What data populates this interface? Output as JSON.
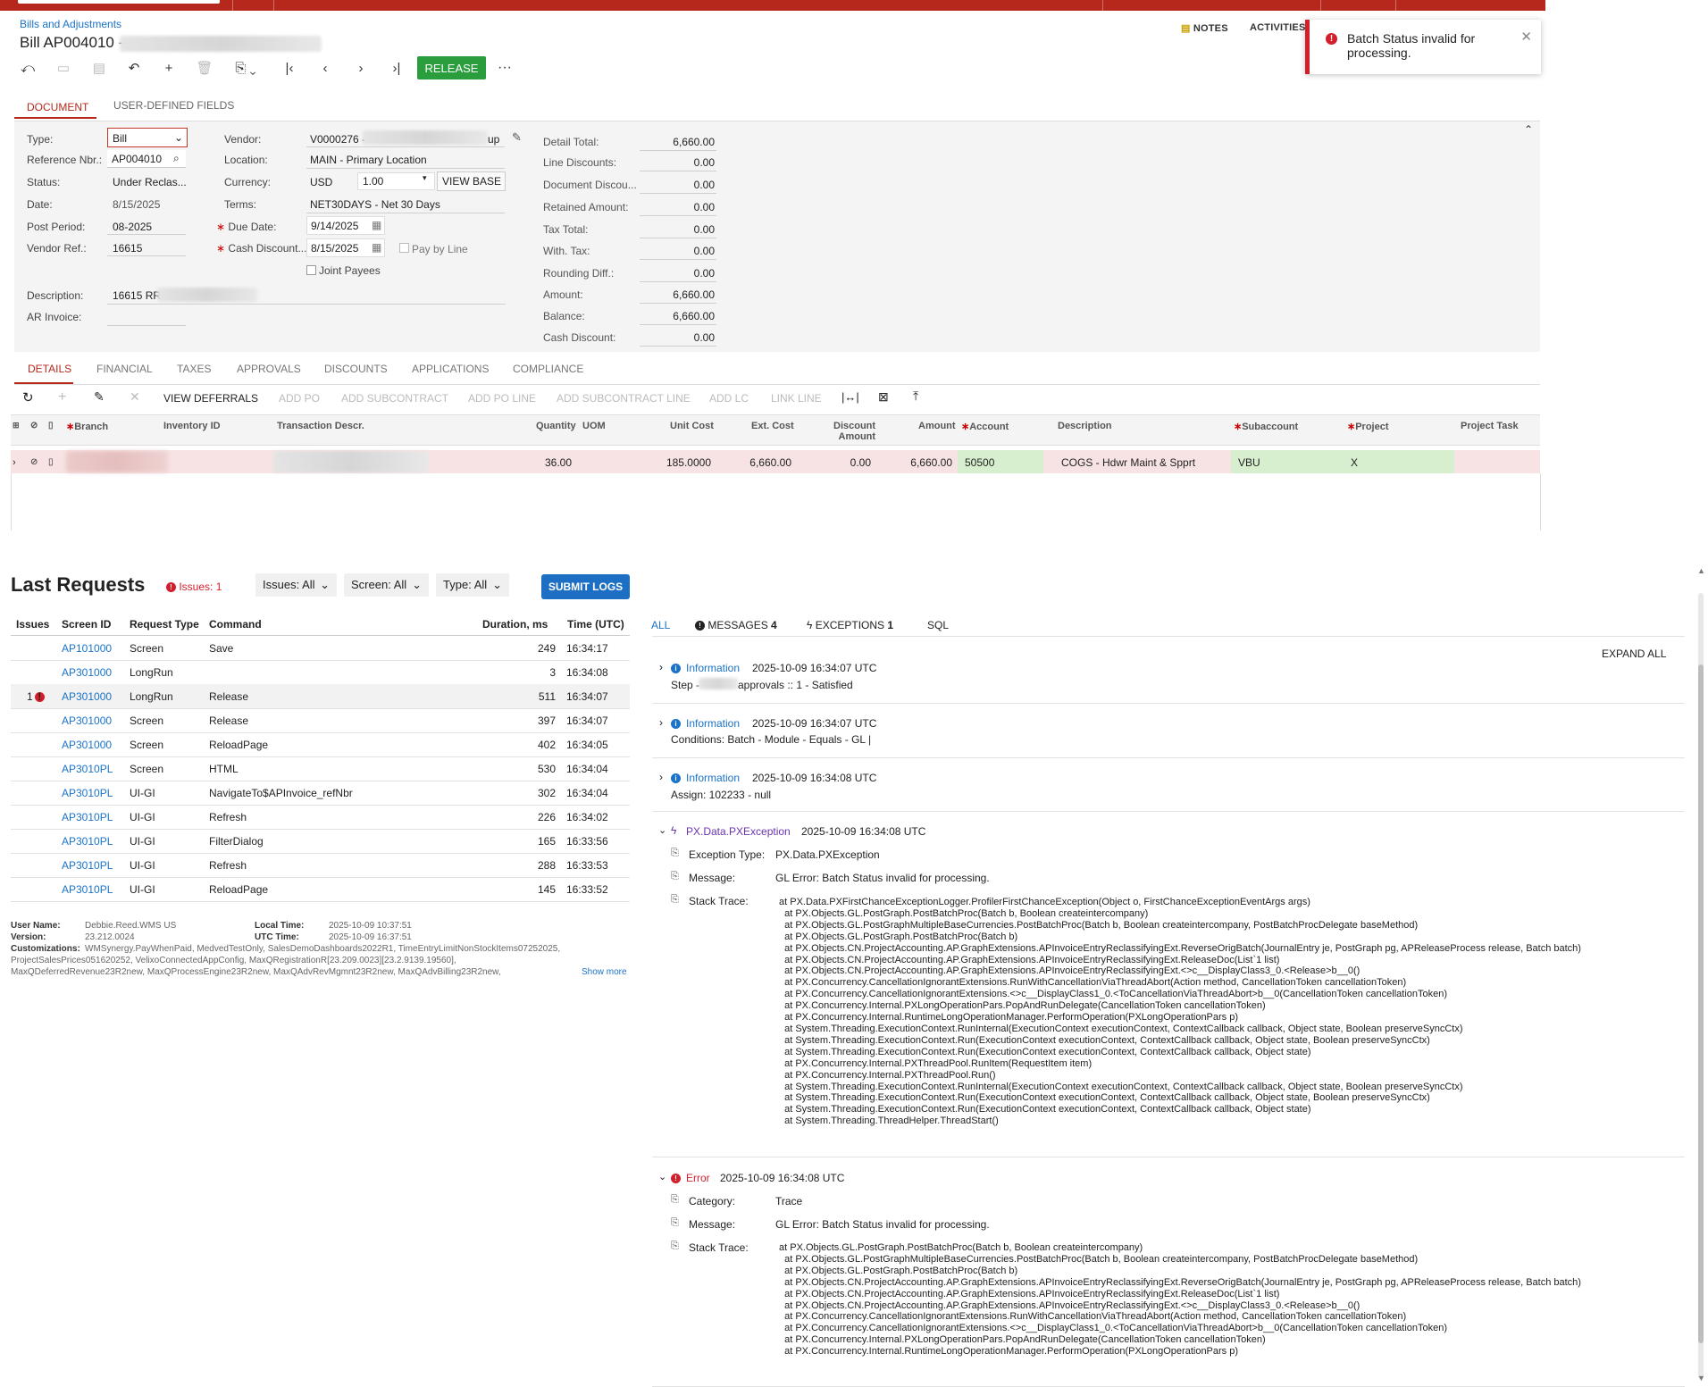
{
  "colors": {
    "brand_red": "#b5281b",
    "release_green": "#2a9d3c",
    "link_blue": "#1a73c8",
    "error_red": "#d21f2b",
    "exception_purple": "#6a33b0"
  },
  "header": {
    "breadcrumb": "Bills and Adjustments",
    "title": "Bill AP004010 -",
    "notes": "NOTES",
    "activities": "ACTIVITIES",
    "release": "RELEASE",
    "more": "···"
  },
  "toast": {
    "message": "Batch Status invalid for processing.",
    "close": "✕",
    "icon": "!"
  },
  "form_tabs": [
    "DOCUMENT",
    "USER-DEFINED FIELDS"
  ],
  "summary": {
    "type_label": "Type:",
    "type_value": "Bill",
    "refnbr_label": "Reference Nbr.:",
    "refnbr_value": "AP004010",
    "status_label": "Status:",
    "status_value": "Under Reclas...",
    "date_label": "Date:",
    "date_value": "8/15/2025",
    "postperiod_label": "Post Period:",
    "postperiod_value": "08-2025",
    "vendorref_label": "Vendor Ref.:",
    "vendorref_value": "16615",
    "description_label": "Description:",
    "description_value": "16615 RR",
    "arinvoice_label": "AR Invoice:",
    "vendor_label": "Vendor:",
    "vendor_value": "V0000276 -",
    "vendor_suffix": "up",
    "location_label": "Location:",
    "location_value": "MAIN - Primary Location",
    "currency_label": "Currency:",
    "currency_value": "USD",
    "rate_value": "1.00",
    "viewbase": "VIEW BASE",
    "terms_label": "Terms:",
    "terms_value": "NET30DAYS - Net 30 Days",
    "duedate_label": "Due Date:",
    "duedate_value": "9/14/2025",
    "cashdisc_label": "Cash Discount...",
    "cashdisc_value": "8/15/2025",
    "paybyline": "Pay by Line",
    "jointpayees": "Joint Payees"
  },
  "totals": [
    {
      "label": "Detail Total:",
      "value": "6,660.00"
    },
    {
      "label": "Line Discounts:",
      "value": "0.00"
    },
    {
      "label": "Document Discou...",
      "value": "0.00"
    },
    {
      "label": "Retained Amount:",
      "value": "0.00"
    },
    {
      "label": "Tax Total:",
      "value": "0.00"
    },
    {
      "label": "With. Tax:",
      "value": "0.00"
    },
    {
      "label": "Rounding Diff.:",
      "value": "0.00"
    },
    {
      "label": "Amount:",
      "value": "6,660.00"
    },
    {
      "label": "Balance:",
      "value": "6,660.00"
    },
    {
      "label": "Cash Discount:",
      "value": "0.00"
    }
  ],
  "grid_tabs": [
    "DETAILS",
    "FINANCIAL",
    "TAXES",
    "APPROVALS",
    "DISCOUNTS",
    "APPLICATIONS",
    "COMPLIANCE"
  ],
  "grid_toolbar": [
    "VIEW DEFERRALS",
    "ADD PO",
    "ADD SUBCONTRACT",
    "ADD PO LINE",
    "ADD SUBCONTRACT LINE",
    "ADD LC",
    "LINK LINE"
  ],
  "grid_headers": {
    "branch": "Branch",
    "inventory": "Inventory ID",
    "trandesc": "Transaction Descr.",
    "quantity": "Quantity",
    "uom": "UOM",
    "unitcost": "Unit Cost",
    "extcost": "Ext. Cost",
    "discamt1": "Discount",
    "discamt2": "Amount",
    "amount": "Amount",
    "account": "Account",
    "description": "Description",
    "subaccount": "Subaccount",
    "project": "Project",
    "projecttask": "Project Task"
  },
  "grid_row": {
    "quantity": "36.00",
    "unitcost": "185.0000",
    "extcost": "6,660.00",
    "discount": "0.00",
    "amount": "6,660.00",
    "account": "50500",
    "description": "COGS - Hdwr Maint & Spprt",
    "subaccount": "VBU",
    "project": "X"
  },
  "requests": {
    "title": "Last Requests",
    "issues_badge": "Issues: 1",
    "filters": [
      "Issues: All",
      "Screen: All",
      "Type: All"
    ],
    "submit": "SUBMIT LOGS",
    "columns": [
      "Issues",
      "Screen ID",
      "Request Type",
      "Command",
      "Duration, ms",
      "Time (UTC)"
    ],
    "rows": [
      {
        "issues": "",
        "screen": "AP101000",
        "type": "Screen",
        "command": "Save",
        "duration": "249",
        "time": "16:34:17"
      },
      {
        "issues": "",
        "screen": "AP301000",
        "type": "LongRun",
        "command": "",
        "duration": "3",
        "time": "16:34:08"
      },
      {
        "issues": "1",
        "screen": "AP301000",
        "type": "LongRun",
        "command": "Release",
        "duration": "511",
        "time": "16:34:07"
      },
      {
        "issues": "",
        "screen": "AP301000",
        "type": "Screen",
        "command": "Release",
        "duration": "397",
        "time": "16:34:07"
      },
      {
        "issues": "",
        "screen": "AP301000",
        "type": "Screen",
        "command": "ReloadPage",
        "duration": "402",
        "time": "16:34:05"
      },
      {
        "issues": "",
        "screen": "AP3010PL",
        "type": "Screen",
        "command": "HTML",
        "duration": "530",
        "time": "16:34:04"
      },
      {
        "issues": "",
        "screen": "AP3010PL",
        "type": "UI-GI",
        "command": "NavigateTo$APInvoice_refNbr",
        "duration": "302",
        "time": "16:34:04"
      },
      {
        "issues": "",
        "screen": "AP3010PL",
        "type": "UI-GI",
        "command": "Refresh",
        "duration": "226",
        "time": "16:34:02"
      },
      {
        "issues": "",
        "screen": "AP3010PL",
        "type": "UI-GI",
        "command": "FilterDialog",
        "duration": "165",
        "time": "16:33:56"
      },
      {
        "issues": "",
        "screen": "AP3010PL",
        "type": "UI-GI",
        "command": "Refresh",
        "duration": "288",
        "time": "16:33:53"
      },
      {
        "issues": "",
        "screen": "AP3010PL",
        "type": "UI-GI",
        "command": "ReloadPage",
        "duration": "145",
        "time": "16:33:52"
      }
    ],
    "meta": {
      "username_label": "User Name:",
      "username": "Debbie.Reed.WMS US",
      "version_label": "Version:",
      "version": "23.212.0024",
      "localtime_label": "Local Time:",
      "localtime": "2025-10-09 10:37:51",
      "utctime_label": "UTC Time:",
      "utctime": "2025-10-09 16:37:51",
      "custom_label": "Customizations:",
      "custom_line1": "WMSynergy.PayWhenPaid, MedvedTestOnly, SalesDemoDashboards2022R1, TimeEntryLimitNonStockItems07252025,",
      "custom_line2": "ProjectSalesPrices051620252, VelixoConnectedAppConfig, MaxQRegistrationR[23.209.0023][23.2.9139.19560],",
      "custom_line3": "MaxQDeferredRevenue23R2new, MaxQProcessEngine23R2new, MaxQAdvRevMgmnt23R2new, MaxQAdvBilling23R2new,",
      "showmore": "Show more"
    }
  },
  "log": {
    "tabs": {
      "all": "ALL",
      "messages": "MESSAGES",
      "messages_count": "4",
      "exceptions": "EXCEPTIONS",
      "exceptions_count": "1",
      "sql": "SQL"
    },
    "expand_all": "EXPAND ALL",
    "entries": [
      {
        "level": "Information",
        "time": "2025-10-09 16:34:07 UTC",
        "text_a": "Step -",
        "text_b": "approvals :: 1 - Satisfied"
      },
      {
        "level": "Information",
        "time": "2025-10-09 16:34:07 UTC",
        "text": "Conditions: Batch - Module - Equals - GL |"
      },
      {
        "level": "Information",
        "time": "2025-10-09 16:34:08 UTC",
        "text": "Assign: 102233 - null"
      }
    ],
    "exception": {
      "title": "PX.Data.PXException",
      "time": "2025-10-09 16:34:08 UTC",
      "type_label": "Exception Type:",
      "type": "PX.Data.PXException",
      "message_label": "Message:",
      "message": "GL Error: Batch Status invalid for processing.",
      "stack_label": "Stack Trace:",
      "stack": "at PX.Data.PXFirstChanceExceptionLogger.ProfilerFirstChanceException(Object o, FirstChanceExceptionEventArgs args)\n  at PX.Objects.GL.PostGraph.PostBatchProc(Batch b, Boolean createintercompany)\n  at PX.Objects.GL.PostGraphMultipleBaseCurrencies.PostBatchProc(Batch b, Boolean createintercompany, PostBatchProcDelegate baseMethod)\n  at PX.Objects.GL.PostGraph.PostBatchProc(Batch b)\n  at PX.Objects.CN.ProjectAccounting.AP.GraphExtensions.APInvoiceEntryReclassifyingExt.ReverseOrigBatch(JournalEntry je, PostGraph pg, APReleaseProcess release, Batch batch)\n  at PX.Objects.CN.ProjectAccounting.AP.GraphExtensions.APInvoiceEntryReclassifyingExt.ReleaseDoc(List`1 list)\n  at PX.Objects.CN.ProjectAccounting.AP.GraphExtensions.APInvoiceEntryReclassifyingExt.<>c__DisplayClass3_0.<Release>b__0()\n  at PX.Concurrency.CancellationIgnorantExtensions.RunWithCancellationViaThreadAbort(Action method, CancellationToken cancellationToken)\n  at PX.Concurrency.CancellationIgnorantExtensions.<>c__DisplayClass1_0.<ToCancellationViaThreadAbort>b__0(CancellationToken cancellationToken)\n  at PX.Concurrency.Internal.PXLongOperationPars.PopAndRunDelegate(CancellationToken cancellationToken)\n  at PX.Concurrency.Internal.RuntimeLongOperationManager.PerformOperation(PXLongOperationPars p)\n  at System.Threading.ExecutionContext.RunInternal(ExecutionContext executionContext, ContextCallback callback, Object state, Boolean preserveSyncCtx)\n  at System.Threading.ExecutionContext.Run(ExecutionContext executionContext, ContextCallback callback, Object state, Boolean preserveSyncCtx)\n  at System.Threading.ExecutionContext.Run(ExecutionContext executionContext, ContextCallback callback, Object state)\n  at PX.Concurrency.Internal.PXThreadPool.RunItem(RequestItem item)\n  at PX.Concurrency.Internal.PXThreadPool.Run()\n  at System.Threading.ExecutionContext.RunInternal(ExecutionContext executionContext, ContextCallback callback, Object state, Boolean preserveSyncCtx)\n  at System.Threading.ExecutionContext.Run(ExecutionContext executionContext, ContextCallback callback, Object state, Boolean preserveSyncCtx)\n  at System.Threading.ExecutionContext.Run(ExecutionContext executionContext, ContextCallback callback, Object state)\n  at System.Threading.ThreadHelper.ThreadStart()"
    },
    "error": {
      "title": "Error",
      "time": "2025-10-09 16:34:08 UTC",
      "category_label": "Category:",
      "category": "Trace",
      "message_label": "Message:",
      "message": "GL Error: Batch Status invalid for processing.",
      "stack_label": "Stack Trace:",
      "stack": "at PX.Objects.GL.PostGraph.PostBatchProc(Batch b, Boolean createintercompany)\n  at PX.Objects.GL.PostGraphMultipleBaseCurrencies.PostBatchProc(Batch b, Boolean createintercompany, PostBatchProcDelegate baseMethod)\n  at PX.Objects.GL.PostGraph.PostBatchProc(Batch b)\n  at PX.Objects.CN.ProjectAccounting.AP.GraphExtensions.APInvoiceEntryReclassifyingExt.ReverseOrigBatch(JournalEntry je, PostGraph pg, APReleaseProcess release, Batch batch)\n  at PX.Objects.CN.ProjectAccounting.AP.GraphExtensions.APInvoiceEntryReclassifyingExt.ReleaseDoc(List`1 list)\n  at PX.Objects.CN.ProjectAccounting.AP.GraphExtensions.APInvoiceEntryReclassifyingExt.<>c__DisplayClass3_0.<Release>b__0()\n  at PX.Concurrency.CancellationIgnorantExtensions.RunWithCancellationViaThreadAbort(Action method, CancellationToken cancellationToken)\n  at PX.Concurrency.CancellationIgnorantExtensions.<>c__DisplayClass1_0.<ToCancellationViaThreadAbort>b__0(CancellationToken cancellationToken)\n  at PX.Concurrency.Internal.PXLongOperationPars.PopAndRunDelegate(CancellationToken cancellationToken)\n  at PX.Concurrency.Internal.RuntimeLongOperationManager.PerformOperation(PXLongOperationPars p)"
    }
  }
}
